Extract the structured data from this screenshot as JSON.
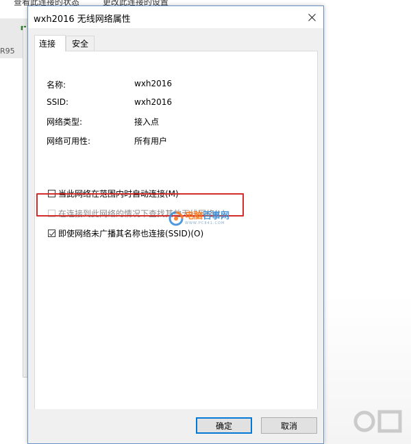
{
  "background": {
    "top_links": [
      "查看此连接的状态",
      "更改此连接的设置"
    ],
    "side_text": "R95"
  },
  "dialog": {
    "title": "wxh2016 无线网络属性",
    "tabs": [
      {
        "label": "连接",
        "active": true
      },
      {
        "label": "安全",
        "active": false
      }
    ],
    "properties": [
      {
        "label": "名称:",
        "value": "wxh2016"
      },
      {
        "label": "SSID:",
        "value": "wxh2016"
      },
      {
        "label": "网络类型:",
        "value": "接入点"
      },
      {
        "label": "网络可用性:",
        "value": "所有用户"
      }
    ],
    "checkboxes": [
      {
        "label": "当此网络在范围内时自动连接(M)",
        "checked": false,
        "disabled": false
      },
      {
        "label": "在连接到此网络的情况下查找其他无线网络(L)",
        "checked": false,
        "disabled": true
      },
      {
        "label": "即使网络未广播其名称也连接(SSID)(O)",
        "checked": true,
        "disabled": false
      }
    ],
    "buttons": {
      "ok": "确定",
      "cancel": "取消"
    }
  },
  "watermark": {
    "main_orange": "电脑",
    "main_blue": "百事网",
    "sub": "WWW.PC841.COM"
  },
  "colors": {
    "highlight": "#d42a2a",
    "accent": "#0078d7",
    "dialog_border": "#6a8fc4"
  }
}
